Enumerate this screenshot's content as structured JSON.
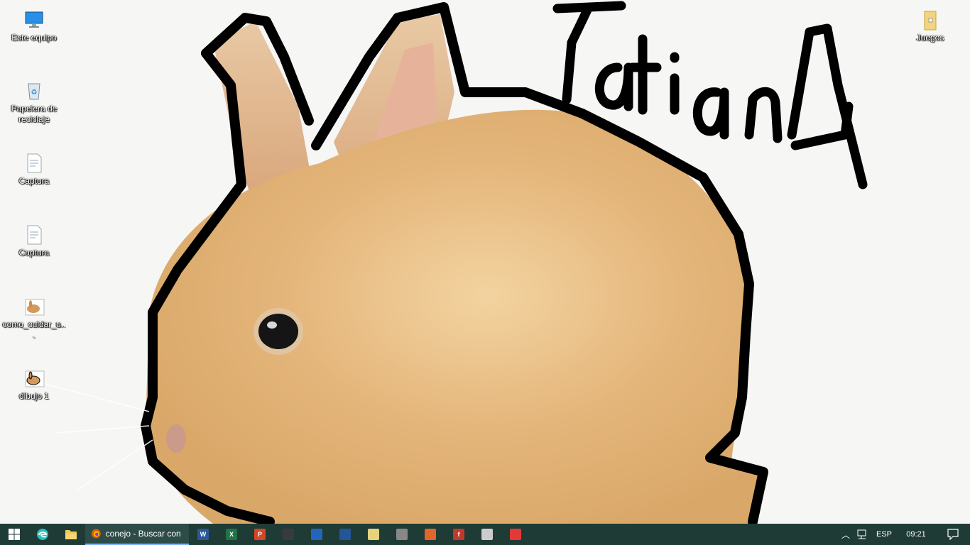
{
  "desktop": {
    "drawn_text": "TatianA",
    "icons": [
      {
        "label": "Este equipo",
        "icon": "computer-icon"
      },
      {
        "label": "Papelera de reciclaje",
        "icon": "recycle-bin-icon"
      },
      {
        "label": "Captura",
        "icon": "screenshot-file-icon"
      },
      {
        "label": "Captura",
        "icon": "screenshot-file-icon"
      },
      {
        "label": "como_cuidar_u...",
        "icon": "image-file-icon"
      },
      {
        "label": "dibujo 1",
        "icon": "image-file-icon"
      },
      {
        "label": "Juegos",
        "icon": "folder-icon"
      }
    ]
  },
  "taskbar": {
    "active_app": {
      "title": "conejo - Buscar con ...",
      "icon": "firefox-icon"
    },
    "pinned": [
      {
        "icon": "word-icon",
        "letter": "W",
        "color": "#2b579a"
      },
      {
        "icon": "excel-icon",
        "letter": "X",
        "color": "#217346"
      },
      {
        "icon": "powerpoint-icon",
        "letter": "P",
        "color": "#d24726"
      },
      {
        "icon": "publisher-icon",
        "letter": "",
        "color": "#3a3a3a"
      },
      {
        "icon": "tool-icon",
        "letter": "",
        "color": "#2266bb"
      },
      {
        "icon": "chart-app-icon",
        "letter": "",
        "color": "#225599"
      },
      {
        "icon": "notepad-icon",
        "letter": "",
        "color": "#e6d27a"
      },
      {
        "icon": "database-icon",
        "letter": "",
        "color": "#888888"
      },
      {
        "icon": "app-icon",
        "letter": "",
        "color": "#e0662a"
      },
      {
        "icon": "flash-icon",
        "letter": "f",
        "color": "#c0392b"
      },
      {
        "icon": "grid-app-icon",
        "letter": "",
        "color": "#cccccc"
      },
      {
        "icon": "media-app-icon",
        "letter": "",
        "color": "#e53935"
      }
    ],
    "tray": {
      "language": "ESP",
      "time": "09:21"
    }
  }
}
